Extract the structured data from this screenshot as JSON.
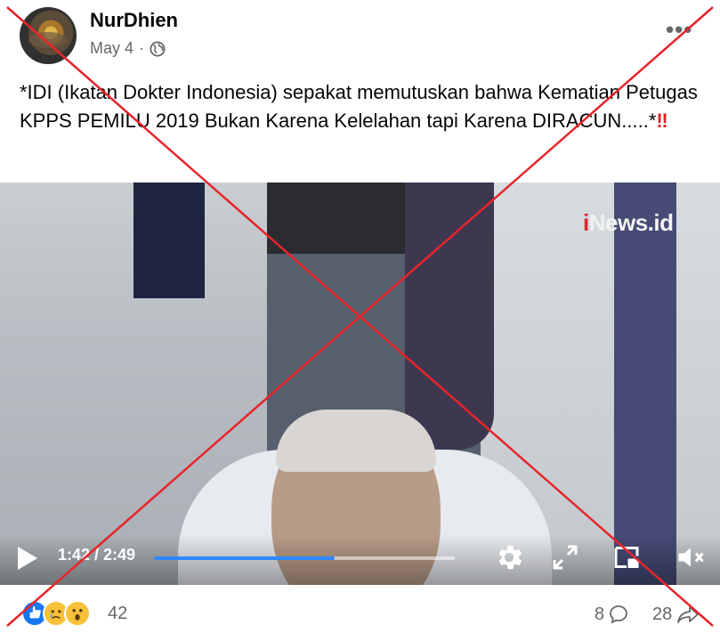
{
  "post": {
    "author": "NurDhien",
    "date": "May 4",
    "separator": "·",
    "privacy_icon": "globe-icon",
    "more_label": "•••",
    "text": "*IDI (Ikatan Dokter Indonesia) sepakat memutuskan bahwa Kematian Petugas KPPS PEMILU 2019 Bukan Karena Kelelahan tapi Karena DIRACUN.....*",
    "text_emoji": "‼"
  },
  "video": {
    "watermark_prefix": "i",
    "watermark_rest": "News.id",
    "time_label": "1:42 / 2:49",
    "progress_fraction": 0.6,
    "accent_color": "#2d88ff"
  },
  "footer": {
    "reaction_icons": [
      "like-icon",
      "sad-icon",
      "wow-icon"
    ],
    "reaction_count": "42",
    "comment_count": "8",
    "share_count": "28"
  },
  "overlay": {
    "cross_color": "#e8242b"
  }
}
